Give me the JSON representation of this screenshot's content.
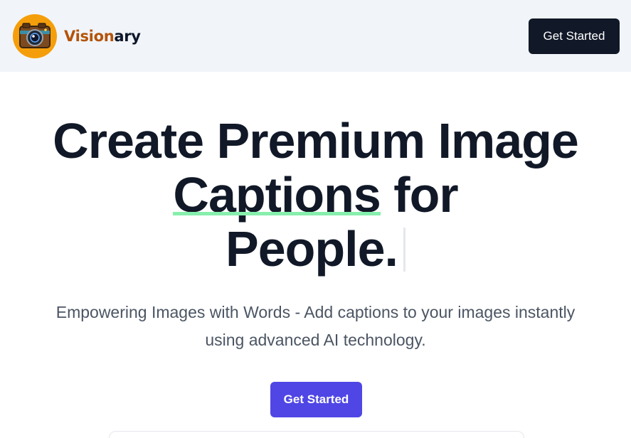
{
  "header": {
    "brand_part1": "Vision",
    "brand_part2": "ary",
    "cta_label": "Get Started"
  },
  "hero": {
    "title_line1": "Create Premium Image",
    "title_highlight": "Captions",
    "title_line2_rest": "for",
    "title_line3": "People.",
    "subtitle": "Empowering Images with Words - Add captions to your images instantly using advanced AI technology.",
    "cta_label": "Get Started"
  },
  "colors": {
    "nav_bg": "#f1f5f9",
    "dark_button": "#111827",
    "primary_button": "#4f46e5",
    "brand_orange": "#b45309",
    "highlight_underline": "#86efac",
    "logo_bg": "#f59e0b"
  },
  "icons": {
    "logo": "camera-icon"
  }
}
